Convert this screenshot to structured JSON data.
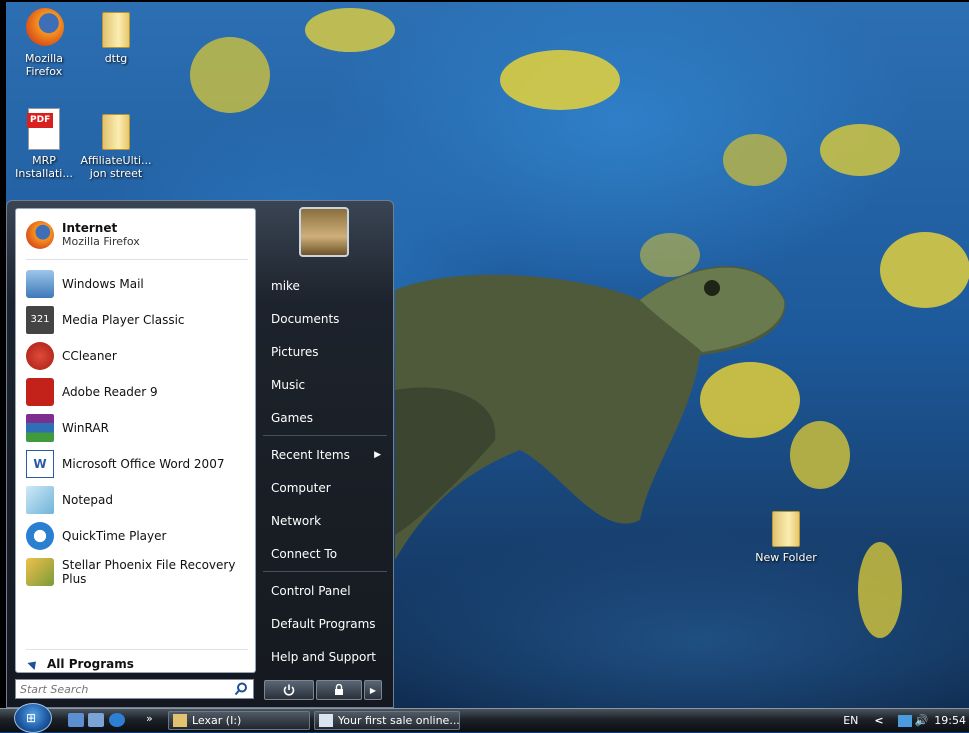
{
  "desktop": {
    "icons": [
      {
        "name": "mozilla-firefox",
        "label1": "Mozilla",
        "label2": "Firefox",
        "icon": "firefox-icon"
      },
      {
        "name": "dttg",
        "label1": "dttg",
        "label2": "",
        "icon": "folder-document-icon"
      },
      {
        "name": "mrp-installation",
        "label1": "MRP",
        "label2": "Installati...",
        "icon": "adobe-pdf-icon"
      },
      {
        "name": "affiliate-ulti",
        "label1": "AffiliateUlti...",
        "label2": "jon street",
        "icon": "folder-icon"
      },
      {
        "name": "new-folder",
        "label1": "New Folder",
        "label2": "",
        "icon": "folder-icon"
      }
    ]
  },
  "start_menu": {
    "pinned": {
      "title": "Internet",
      "subtitle": "Mozilla Firefox"
    },
    "recent": [
      {
        "label": "Windows Mail",
        "icon": "mail-icon"
      },
      {
        "label": "Media Player Classic",
        "icon": "media-player-icon"
      },
      {
        "label": "CCleaner",
        "icon": "ccleaner-icon"
      },
      {
        "label": "Adobe Reader 9",
        "icon": "adobe-reader-icon"
      },
      {
        "label": "WinRAR",
        "icon": "winrar-icon"
      },
      {
        "label": "Microsoft Office Word 2007",
        "icon": "word-icon"
      },
      {
        "label": "Notepad",
        "icon": "notepad-icon"
      },
      {
        "label": "QuickTime Player",
        "icon": "quicktime-icon"
      },
      {
        "label": "Stellar Phoenix File Recovery Plus",
        "icon": "recovery-icon"
      }
    ],
    "all_programs": "All Programs",
    "search_placeholder": "Start Search",
    "right": [
      "mike",
      "Documents",
      "Pictures",
      "Music",
      "Games",
      "Recent Items",
      "Computer",
      "Network",
      "Connect To",
      "Control Panel",
      "Default Programs",
      "Help and Support"
    ]
  },
  "taskbar": {
    "overflow": "»",
    "tasks": [
      "Lexar (I:)",
      "Your first sale online..."
    ],
    "language": "EN",
    "tray_arrow": "<",
    "clock": "19:54"
  }
}
